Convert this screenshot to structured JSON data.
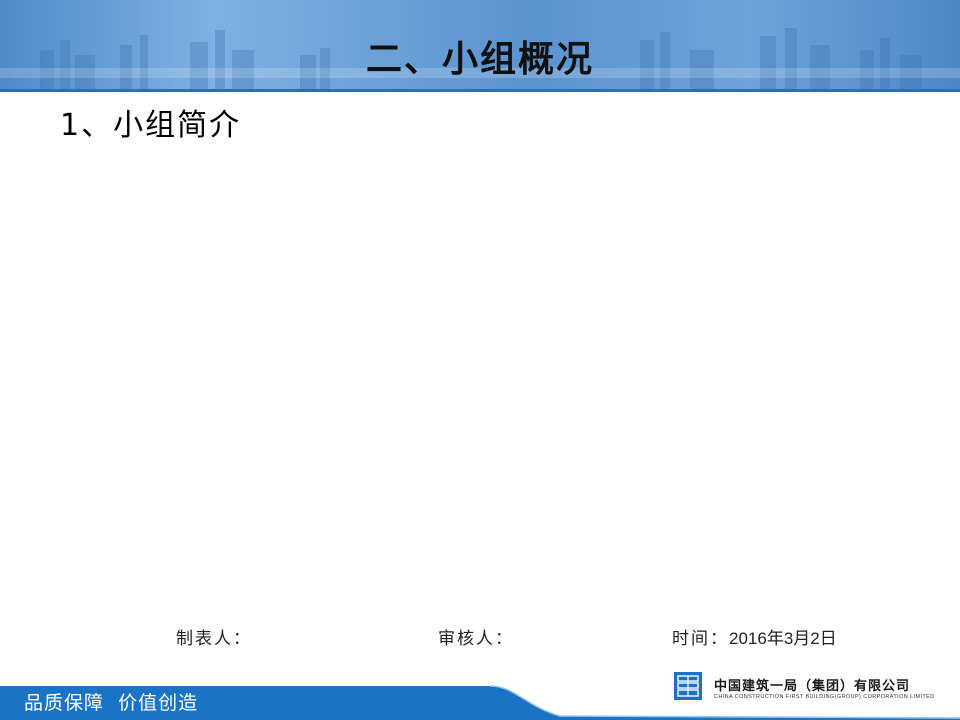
{
  "header": {
    "title": "二、小组概况"
  },
  "content": {
    "subtitle": "1、小组简介"
  },
  "signature_row": {
    "maker_label": "制表人：",
    "reviewer_label": "审核人：",
    "time_label": "时间：",
    "time_value": "2016年3月2日"
  },
  "footer": {
    "slogan": "品质保障  价值创造",
    "company_name_cn": "中国建筑一局（集团）有限公司",
    "company_name_en": "CHINA CONSTRUCTION FIRST BUILDING(GROUP) CORPORATION LIMITED",
    "logo_icon": "company-logo-icon"
  },
  "colors": {
    "header_blue": "#5b93cf",
    "footer_blue": "#1a73c4",
    "title_text": "#111111"
  }
}
